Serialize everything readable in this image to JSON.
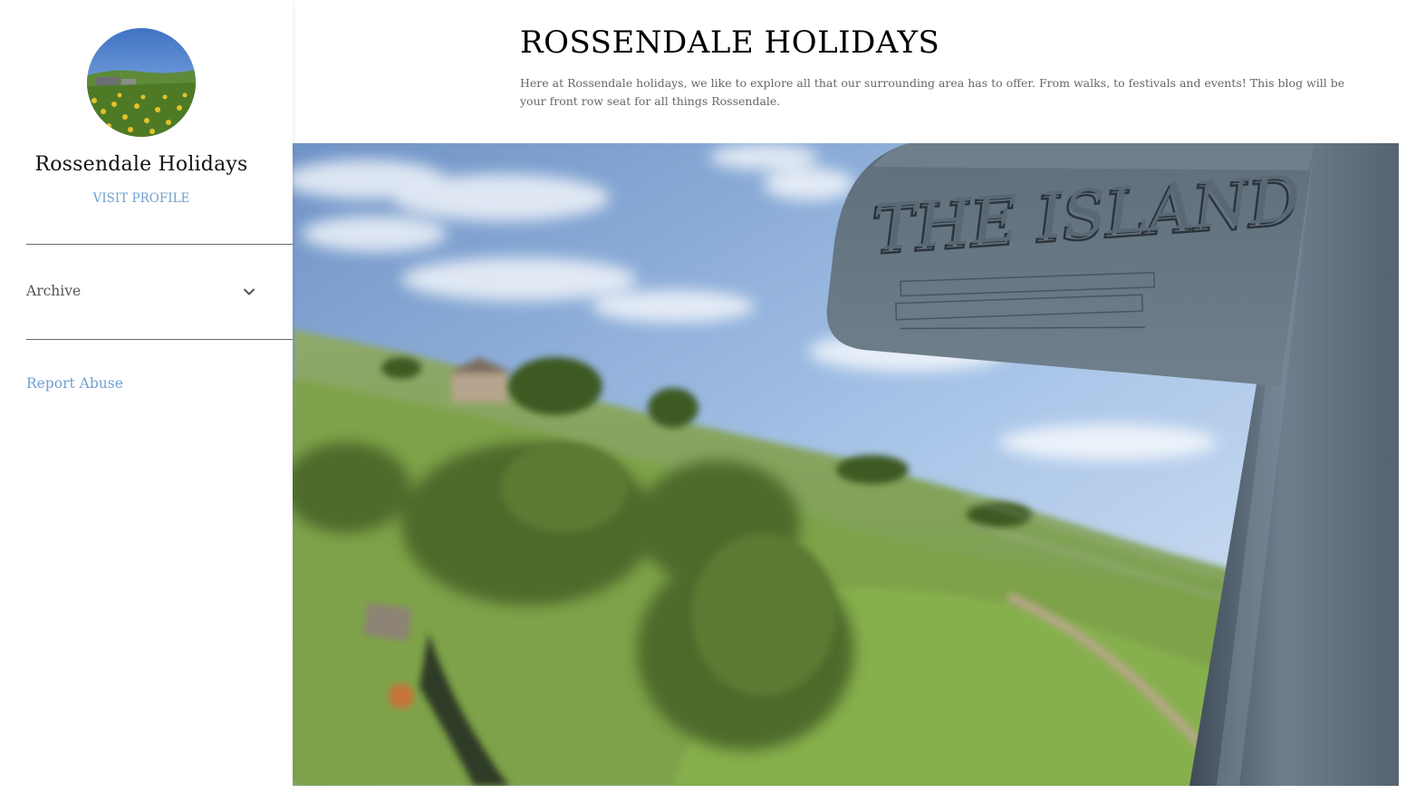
{
  "sidebar": {
    "profile_name": "Rossendale Holidays",
    "visit_profile_label": "VISIT PROFILE",
    "archive_label": "Archive",
    "report_abuse_label": "Report Abuse"
  },
  "header": {
    "title": "ROSSENDALE HOLIDAYS",
    "description": "Here at Rossendale holidays, we like to explore all that our surrounding area has to offer. From walks, to festivals and events! This blog will be your front row seat for all things Rossendale."
  },
  "hero": {
    "sign_text": "THE ISLAND"
  },
  "colors": {
    "link": "#6fa0d2",
    "title": "#000000",
    "text_muted": "#666666",
    "divider": "#6a6a6a"
  },
  "icons": {
    "archive_toggle": "chevron-down-icon"
  }
}
